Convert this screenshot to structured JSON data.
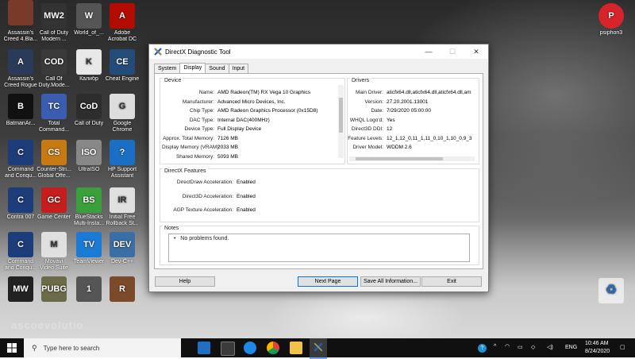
{
  "desktop_icons": [
    {
      "label1": "Assassin's",
      "label2": "Creed 4.Bla...",
      "color": "#2b2b2b",
      "glyph": "A"
    },
    {
      "label1": "Call of Duty",
      "label2": "Modern ...",
      "color": "#333",
      "glyph": "MW2"
    },
    {
      "label1": "World_of_...",
      "label2": "",
      "color": "#555",
      "glyph": "W"
    },
    {
      "label1": "Adobe",
      "label2": "Acrobat DC",
      "color": "#b30b00",
      "glyph": "A"
    },
    {
      "label1": "Assassin's",
      "label2": "Creed Rogue",
      "color": "#2a3b5a",
      "glyph": "A"
    },
    {
      "label1": "Call Of",
      "label2": "Duty.Mode...",
      "color": "#3a3a3a",
      "glyph": "COD"
    },
    {
      "label1": "Калибр",
      "label2": "",
      "color": "#e8e8e8",
      "glyph": "K"
    },
    {
      "label1": "Cheat Engine",
      "label2": "",
      "color": "#244c7a",
      "glyph": "CE"
    },
    {
      "label1": "BatmanAr...",
      "label2": "",
      "color": "#111",
      "glyph": "B"
    },
    {
      "label1": "Total",
      "label2": "Command...",
      "color": "#3b5db0",
      "glyph": "TC"
    },
    {
      "label1": "Call of Duty",
      "label2": "",
      "color": "#2d2d2d",
      "glyph": "CoD"
    },
    {
      "label1": "Google",
      "label2": "Chrome",
      "color": "#dddddd",
      "glyph": "G"
    },
    {
      "label1": "Command",
      "label2": "and Conqu...",
      "color": "#1d3c7a",
      "glyph": "C"
    },
    {
      "label1": "Counter-Stri...",
      "label2": "Global Offe...",
      "color": "#c87a12",
      "glyph": "CS"
    },
    {
      "label1": "UltraISO",
      "label2": "",
      "color": "#888",
      "glyph": "ISO"
    },
    {
      "label1": "HP Support",
      "label2": "Assistant",
      "color": "#1a6fc4",
      "glyph": "?"
    },
    {
      "label1": "Contra 007",
      "label2": "",
      "color": "#1d3c7a",
      "glyph": "C"
    },
    {
      "label1": "Game Center",
      "label2": "",
      "color": "#c41e1e",
      "glyph": "GC"
    },
    {
      "label1": "BlueStacks",
      "label2": "Multi-Insta...",
      "color": "#3aa03a",
      "glyph": "BS"
    },
    {
      "label1": "Initial Free",
      "label2": "Rollback St...",
      "color": "#e0e0e0",
      "glyph": "IR"
    },
    {
      "label1": "Command",
      "label2": "and Conqu...",
      "color": "#1d3c7a",
      "glyph": "C"
    },
    {
      "label1": "Movavi",
      "label2": "Video Suite",
      "color": "#e0e0e0",
      "glyph": "M"
    },
    {
      "label1": "TeamViewer",
      "label2": "",
      "color": "#1a7ad6",
      "glyph": "TV"
    },
    {
      "label1": "Dev-C++",
      "label2": "",
      "color": "#3a6ea5",
      "glyph": "DEV"
    },
    {
      "label1": "",
      "label2": "",
      "color": "#222",
      "glyph": "MW"
    },
    {
      "label1": "",
      "label2": "",
      "color": "#6b6b4a",
      "glyph": "PUBG"
    },
    {
      "label1": "",
      "label2": "",
      "color": "#555",
      "glyph": "1"
    },
    {
      "label1": "",
      "label2": "",
      "color": "#7a4a2a",
      "glyph": "R"
    },
    {
      "label1": "",
      "label2": "",
      "color": "#7a3a2a",
      "glyph": ""
    }
  ],
  "psiphon": {
    "label": "psiphon3",
    "color": "#d9232b",
    "glyph": "P"
  },
  "recycle_bin": {
    "glyph": "♻"
  },
  "window": {
    "title": "DirectX Diagnostic Tool",
    "tabs": [
      "System",
      "Display",
      "Sound",
      "Input"
    ],
    "device": {
      "title": "Device",
      "rows": [
        {
          "k": "Name:",
          "v": "AMD Radeon(TM) RX Vega 10 Graphics"
        },
        {
          "k": "Manufacturer:",
          "v": "Advanced Micro Devices, Inc."
        },
        {
          "k": "Chip Type:",
          "v": "AMD Radeon Graphics Processor (0x15D8)"
        },
        {
          "k": "DAC Type:",
          "v": "Internal DAC(400MHz)"
        },
        {
          "k": "Device Type:",
          "v": "Full Display Device"
        },
        {
          "k": "Approx. Total Memory:",
          "v": "7126 MB"
        },
        {
          "k": "Display Memory (VRAM):",
          "v": "2033 MB"
        },
        {
          "k": "Shared Memory:",
          "v": "5093 MB"
        }
      ]
    },
    "drivers": {
      "title": "Drivers",
      "rows": [
        {
          "k": "Main Driver:",
          "v": "aticfx64.dll,aticfx64.dll,aticfx64.dll,am"
        },
        {
          "k": "Version:",
          "v": "27.20.2001.13001"
        },
        {
          "k": "Date:",
          "v": "7/29/2020 05:00:00"
        },
        {
          "k": "WHQL Logo'd:",
          "v": "Yes"
        },
        {
          "k": "Direct3D DDI:",
          "v": "12"
        },
        {
          "k": "Feature Levels:",
          "v": "12_1,12_0,11_1,11_0,10_1,10_0,9_3"
        },
        {
          "k": "Driver Model:",
          "v": "WDDM 2.6"
        }
      ]
    },
    "features": {
      "title": "DirectX Features",
      "rows": [
        {
          "k": "DirectDraw Acceleration:",
          "v": "Enabled"
        },
        {
          "k": "Direct3D Acceleration:",
          "v": "Enabled"
        },
        {
          "k": "AGP Texture Acceleration:",
          "v": "Enabled"
        }
      ]
    },
    "notes": {
      "title": "Notes",
      "items": [
        "No problems found."
      ]
    },
    "buttons": {
      "help": "Help",
      "next": "Next Page",
      "save": "Save All Information...",
      "exit": "Exit"
    }
  },
  "taskbar": {
    "search_placeholder": "Type here to search",
    "time": "10:46 AM",
    "date": "8/24/2020",
    "lang": "ENG"
  },
  "watermark": "ascoevolutio"
}
